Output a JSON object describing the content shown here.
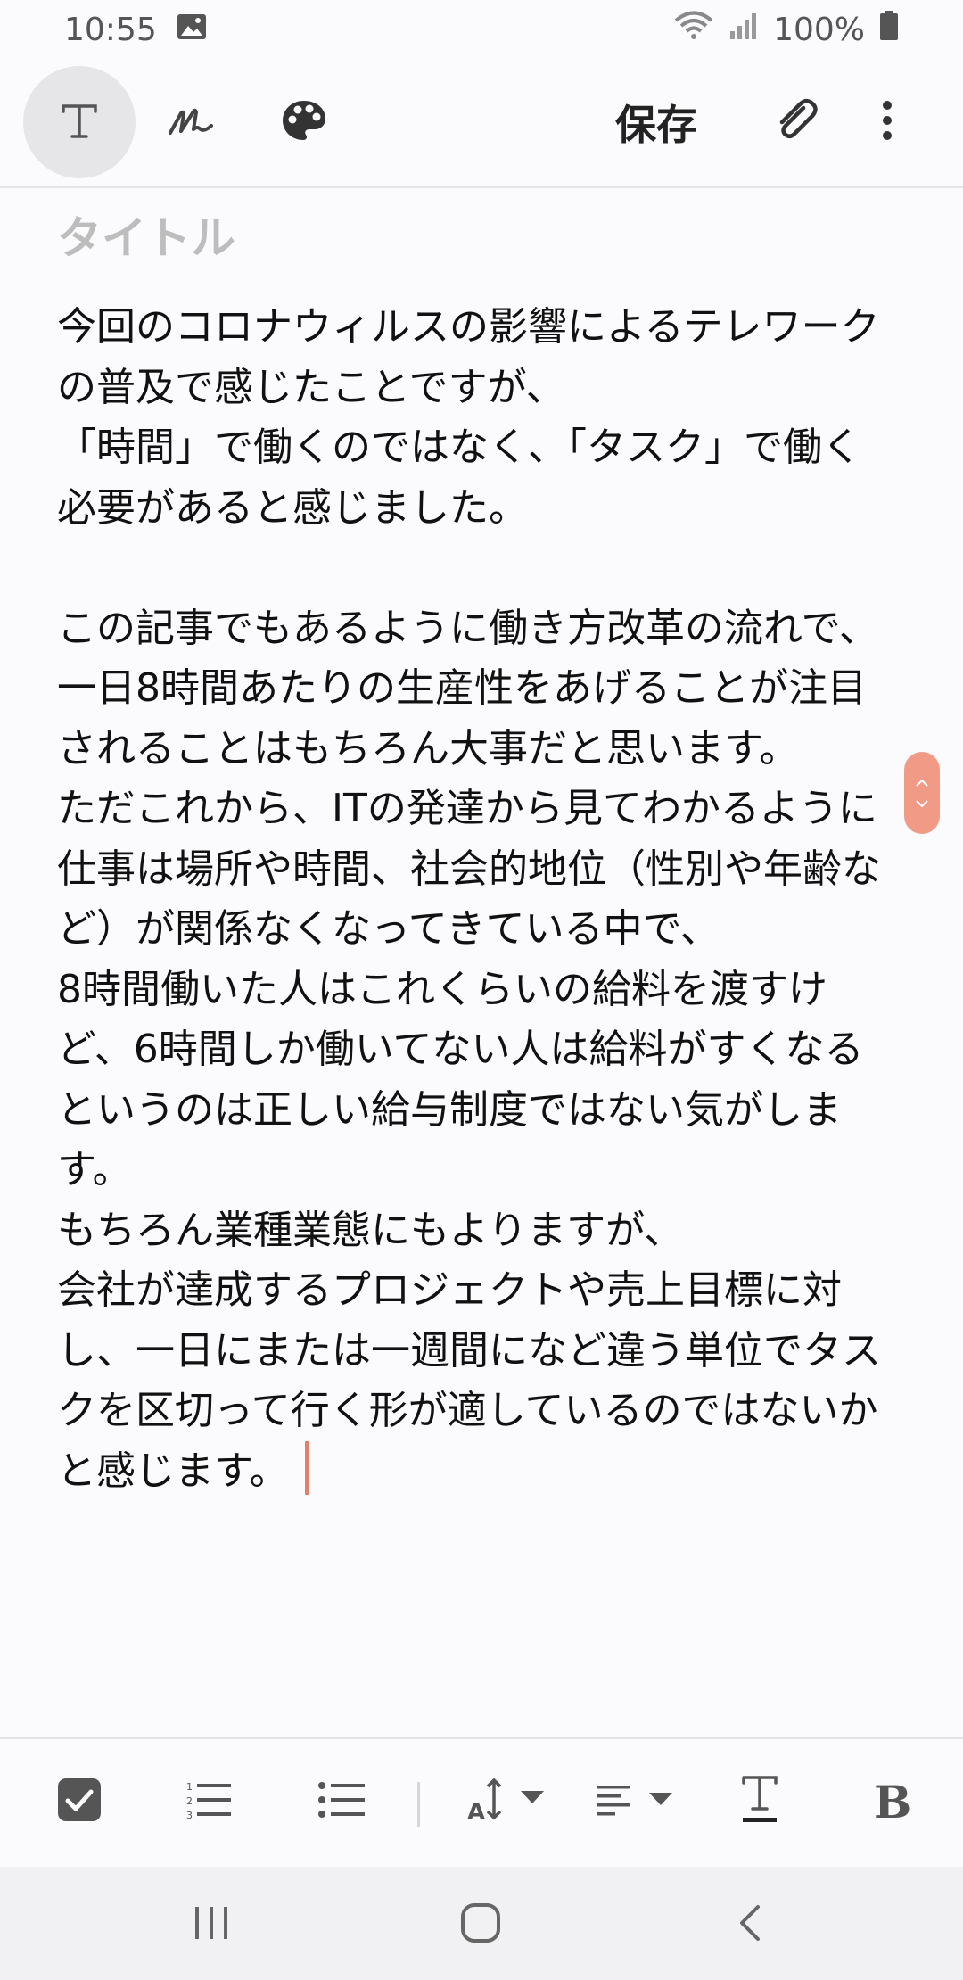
{
  "status_bar": {
    "time": "10:55",
    "battery": "100%"
  },
  "toolbar": {
    "text_mode_icon": "text-icon",
    "handwriting_icon": "handwriting-icon",
    "palette_icon": "palette-icon",
    "save_label": "保存",
    "attach_icon": "paperclip-icon",
    "more_icon": "more-vert-icon"
  },
  "editor": {
    "title_placeholder": "タイトル",
    "body": "今回のコロナウィルスの影響によるテレワークの普及で感じたことですが、\n「時間」で働くのではなく、「タスク」で働く必要があると感じました。\n\nこの記事でもあるように働き方改革の流れで、一日8時間あたりの生産性をあげることが注目されることはもちろん大事だと思います。\nただこれから、ITの発達から見てわかるように仕事は場所や時間、社会的地位（性別や年齢など）が関係なくなってきている中で、\n8時間働いた人はこれくらいの給料を渡すけど、6時間しか働いてない人は給料がすくなるというのは正しい給与制度ではない気がします。\nもちろん業種業態にもよりますが、\n会社が達成するプロジェクトや売上目標に対し、一日にまたは一週間になど違う単位でタスクを区切って行く形が適しているのではないかと感じます。"
  },
  "colors": {
    "accent": "#e2806b",
    "scroll_handle": "#f19a86"
  }
}
